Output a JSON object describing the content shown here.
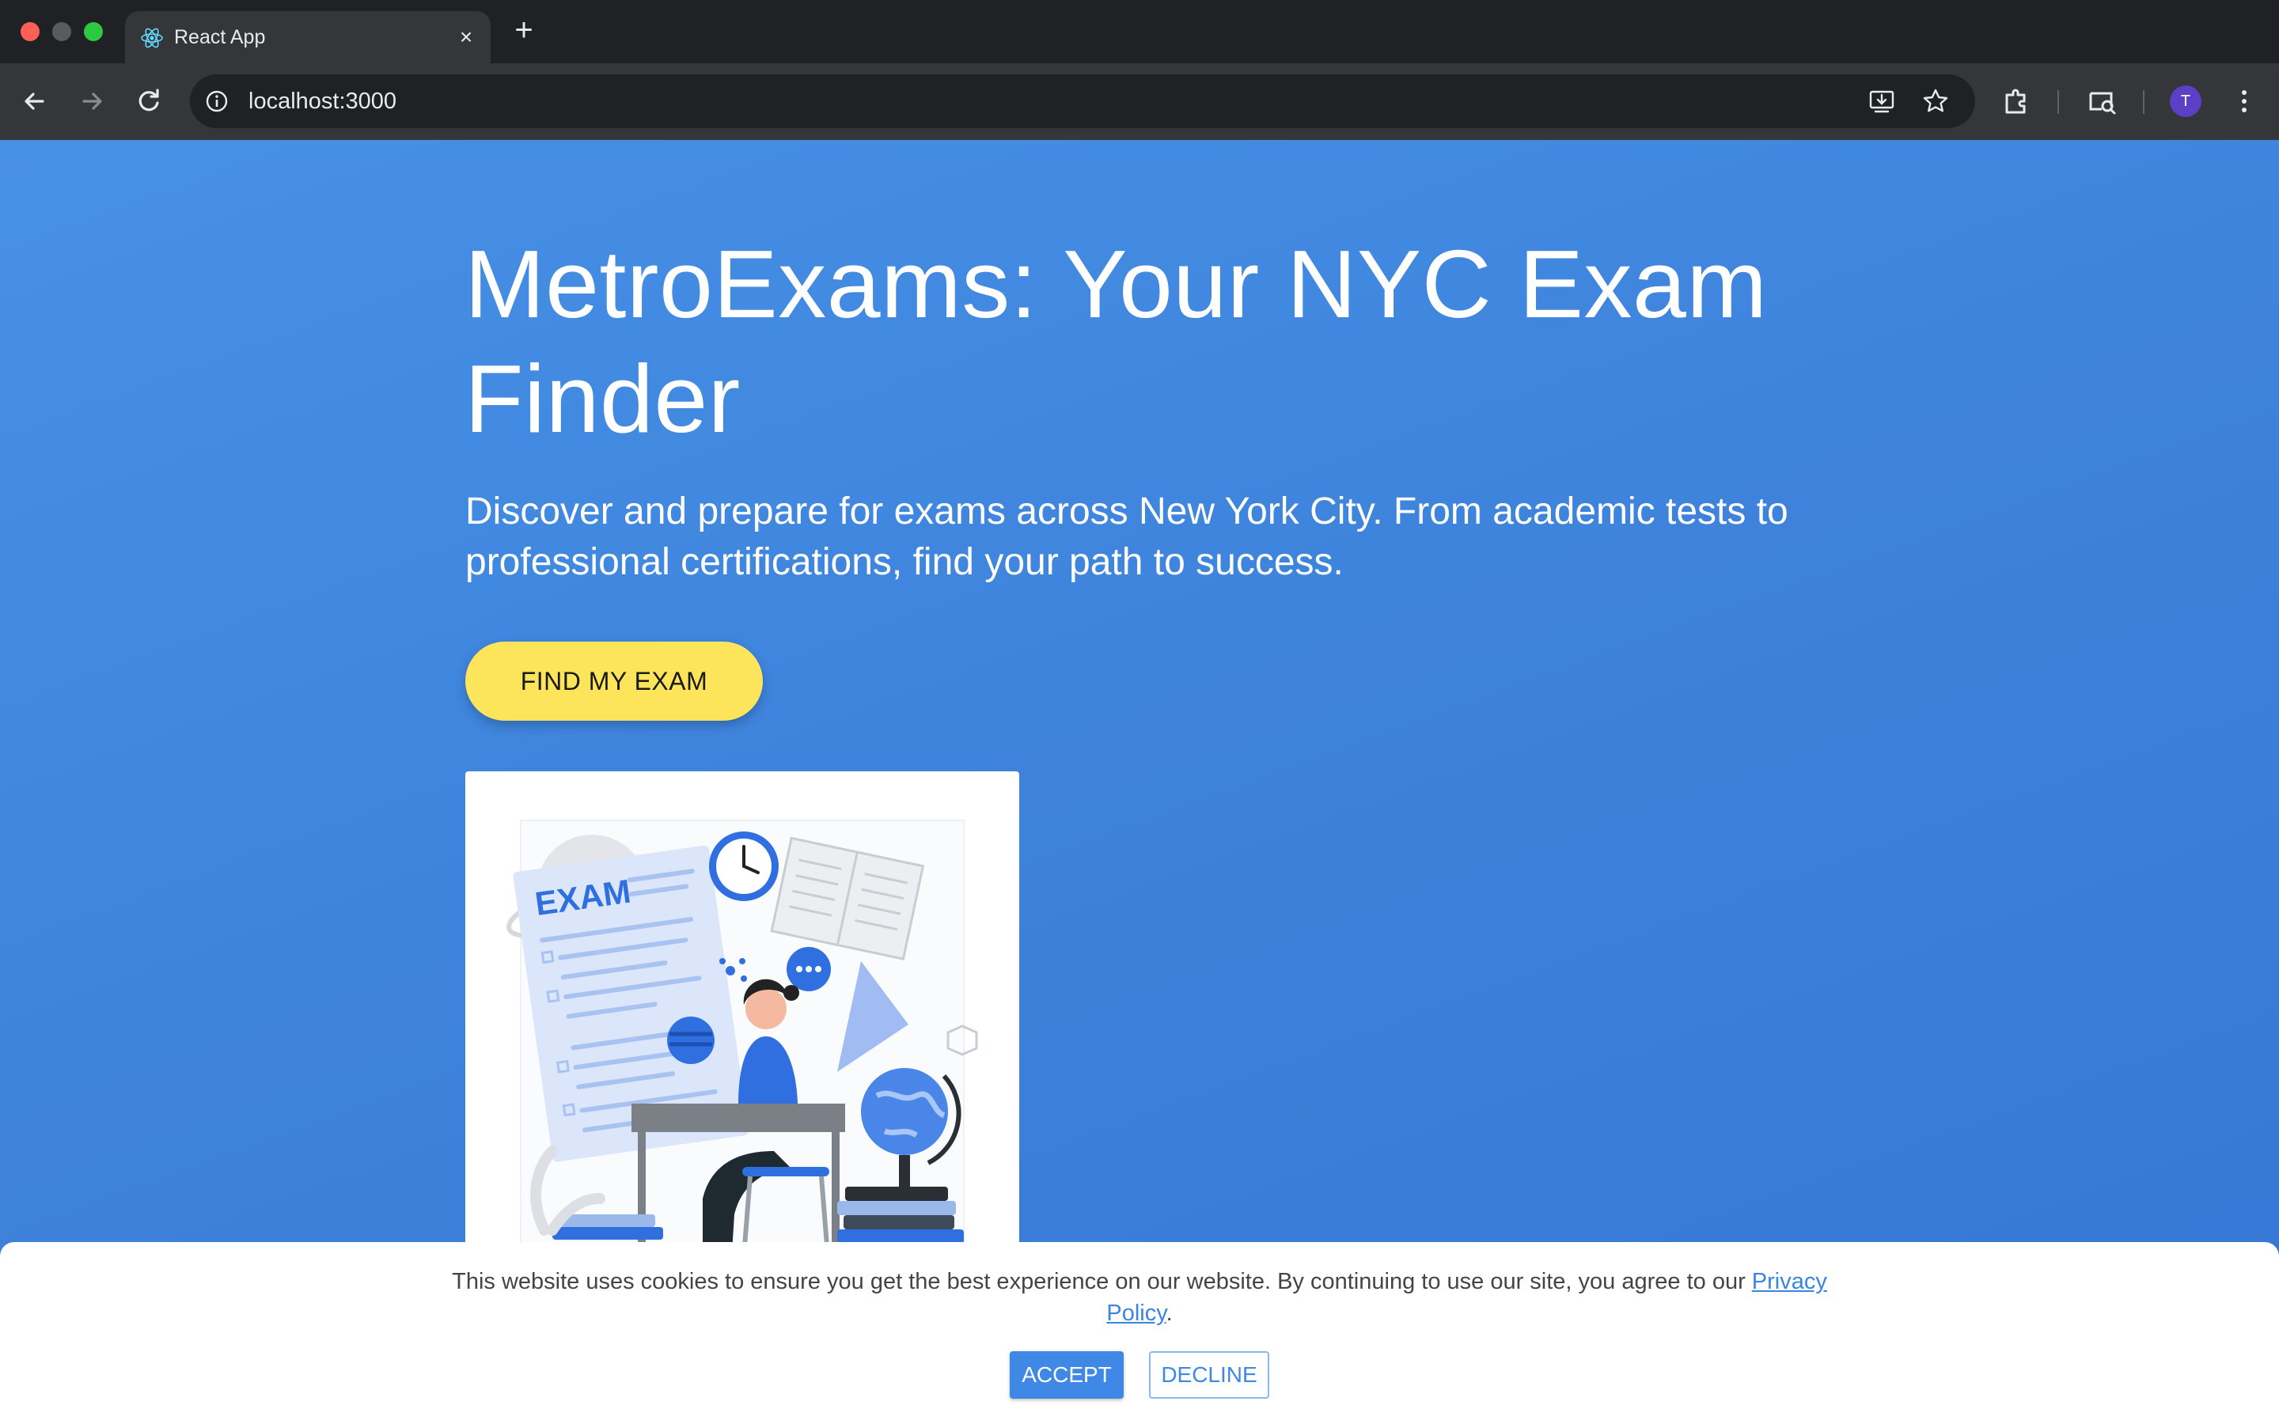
{
  "browser": {
    "tab_title": "React App",
    "tab_close": "×",
    "new_tab": "+",
    "url": "localhost:3000",
    "profile_initial": "T"
  },
  "hero": {
    "title": "MetroExams: Your NYC Exam Finder",
    "subtitle": "Discover and prepare for exams across New York City. From academic tests to professional certifications, find your path to success.",
    "cta_label": "FIND MY EXAM",
    "illustration_text": "EXAM"
  },
  "cookie_banner": {
    "message": "This website uses cookies to ensure you get the best experience on our website. By continuing to use our site, you agree to our ",
    "link_label": "Privacy Policy",
    "suffix": ".",
    "accept_label": "ACCEPT",
    "decline_label": "DECLINE"
  },
  "colors": {
    "page_blue": "#3f85dd",
    "cta_yellow": "#fce55a",
    "accept_blue": "#3f88e5"
  }
}
